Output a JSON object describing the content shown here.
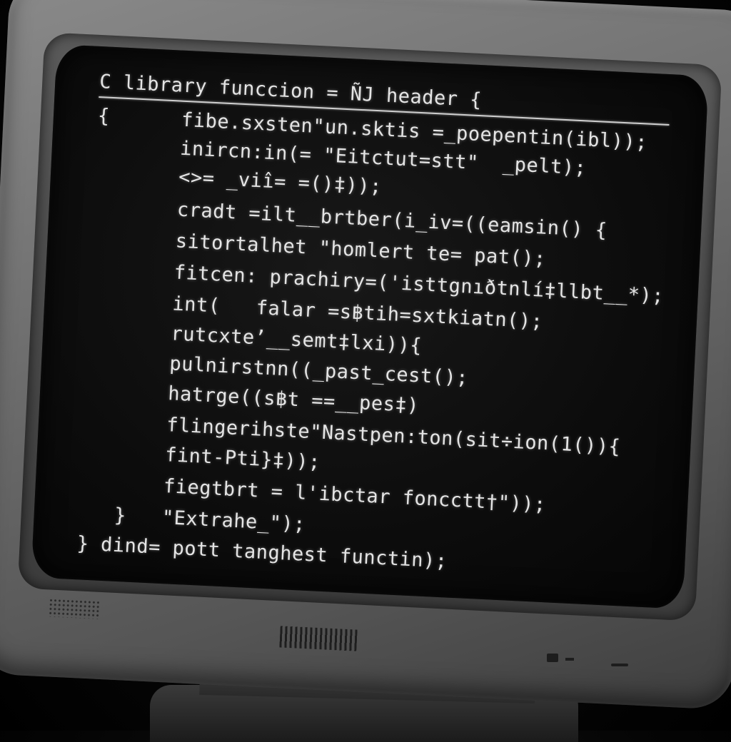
{
  "screen_code": {
    "header": "C library funccion = ÑЈ header {",
    "lines": [
      "{      fibe.sxsten\"un.sktis =_poepentin(ibl));",
      "       inircn:in(= \"Eitctut=stt\"  _pelt);",
      "       <>= _viî= =()‡));",
      "       cradt =ilt__brtber(i_iv=((eamsin() {",
      "       sitortalhet \"homlert te= pat();",
      "       fitcen: prachiry=('isttgnıðtnlí‡llbt__*);",
      "       int(   falar =s฿tih=sxtkiatn();",
      "       rutcxte’__semt‡lxi)){",
      "       pulnirstnn((_past_cest();",
      "       hatrge((s฿t ==__pes‡)",
      "       flingerihste\"Nastpen:ton(sit÷ion(1()){",
      "       fint-Pti}‡));",
      "       fiegtbrt = l'ibctar foncctt†\"));",
      "   }   \"Extrahe_\");",
      "} dind= pott tanghest functin);"
    ]
  }
}
